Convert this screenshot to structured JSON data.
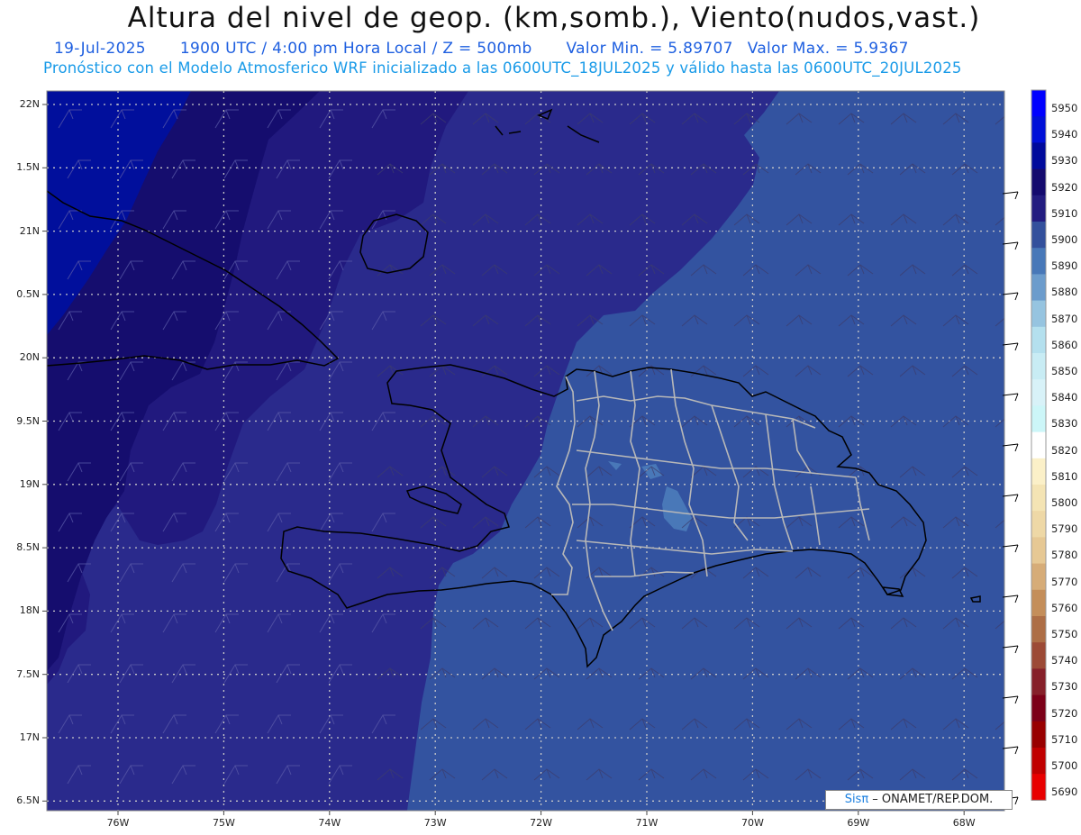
{
  "header": {
    "title": "Altura del nivel de geop. (km,somb.), Viento(nudos,vast.)",
    "date": "19-Jul-2025",
    "time": "1900 UTC / 4:00 pm Hora Local / Z = 500mb",
    "min": "Valor Min. = 5.89707",
    "max": "Valor Max. = 5.9367",
    "subtitle": "Pronóstico con el Modelo Atmosferico WRF inicializado a las 0600UTC_18JUL2025 y válido hasta las  0600UTC_20JUL2025"
  },
  "map": {
    "lat_labels": [
      "22N",
      "1.5N",
      "21N",
      "0.5N",
      "20N",
      "9.5N",
      "19N",
      "8.5N",
      "18N",
      "7.5N",
      "17N",
      "6.5N"
    ],
    "lon_labels": [
      "76W",
      "75W",
      "74W",
      "73W",
      "72W",
      "71W",
      "70W",
      "69W",
      "68W"
    ],
    "fill_colors": {
      "5940": "#010f9c",
      "5930": "#150d6e",
      "5920": "#21197e",
      "5910": "#2a2a8c",
      "5900": "#3353a0",
      "5890": "#4978b8",
      "coast": "#000000",
      "borders": "#b8b8b8",
      "grid": "#c8c8c8"
    }
  },
  "colorbar": {
    "levels": [
      "5950",
      "5940",
      "5930",
      "5920",
      "5910",
      "5900",
      "5890",
      "5880",
      "5870",
      "5860",
      "5850",
      "5840",
      "5830",
      "5820",
      "5810",
      "5800",
      "5790",
      "5780",
      "5770",
      "5760",
      "5750",
      "5740",
      "5730",
      "5720",
      "5710",
      "5700",
      "5690"
    ],
    "colors": [
      "#0000ff",
      "#0010d8",
      "#000a9c",
      "#140a6e",
      "#231c80",
      "#33509c",
      "#4878b8",
      "#6c9ccc",
      "#96c4e0",
      "#b4e0ee",
      "#c8ecf4",
      "#d8f2f8",
      "#ccf6f8",
      "#ffffff",
      "#fbf0c8",
      "#f4e4b4",
      "#eed8a6",
      "#e6c894",
      "#d6ac78",
      "#c48e5a",
      "#ad6e46",
      "#9c4a36",
      "#86202a",
      "#7c0018",
      "#980000",
      "#c00000",
      "#e80000"
    ]
  },
  "credit": {
    "sis": "Sisπ",
    "rest": " – ONAMET/REP.DOM."
  }
}
